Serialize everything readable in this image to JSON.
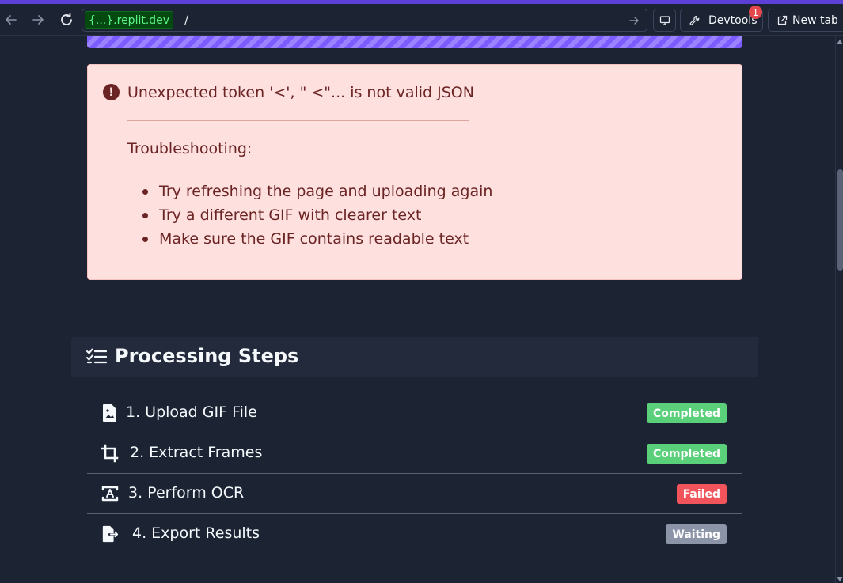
{
  "browser": {
    "url_host_prefix": "{...}",
    "url_host_rest": ".replit.dev",
    "url_path": "/",
    "devtools_label": "Devtools",
    "devtools_badge": "1",
    "newtab_label": "New tab"
  },
  "error": {
    "message": "Unexpected token '<', \" <\"... is not valid JSON",
    "troubleshooting_title": "Troubleshooting:",
    "tips": [
      "Try refreshing the page and uploading again",
      "Try a different GIF with clearer text",
      "Make sure the GIF contains readable text"
    ]
  },
  "steps": {
    "title": "Processing Steps",
    "items": [
      {
        "label": "1. Upload GIF File",
        "status": "Completed",
        "status_color": "#5bd07a",
        "icon": "file-image-icon"
      },
      {
        "label": "2. Extract Frames",
        "status": "Completed",
        "status_color": "#5bd07a",
        "icon": "crop-icon"
      },
      {
        "label": "3. Perform OCR",
        "status": "Failed",
        "status_color": "#f2545b",
        "icon": "text-scan-icon"
      },
      {
        "label": "4. Export Results",
        "status": "Waiting",
        "status_color": "#8c94a8",
        "icon": "file-export-icon"
      }
    ]
  },
  "colors": {
    "background": "#1c2333",
    "error_bg": "#fee0df",
    "error_text": "#6b2424",
    "accent_purple": "#7c5cff"
  }
}
